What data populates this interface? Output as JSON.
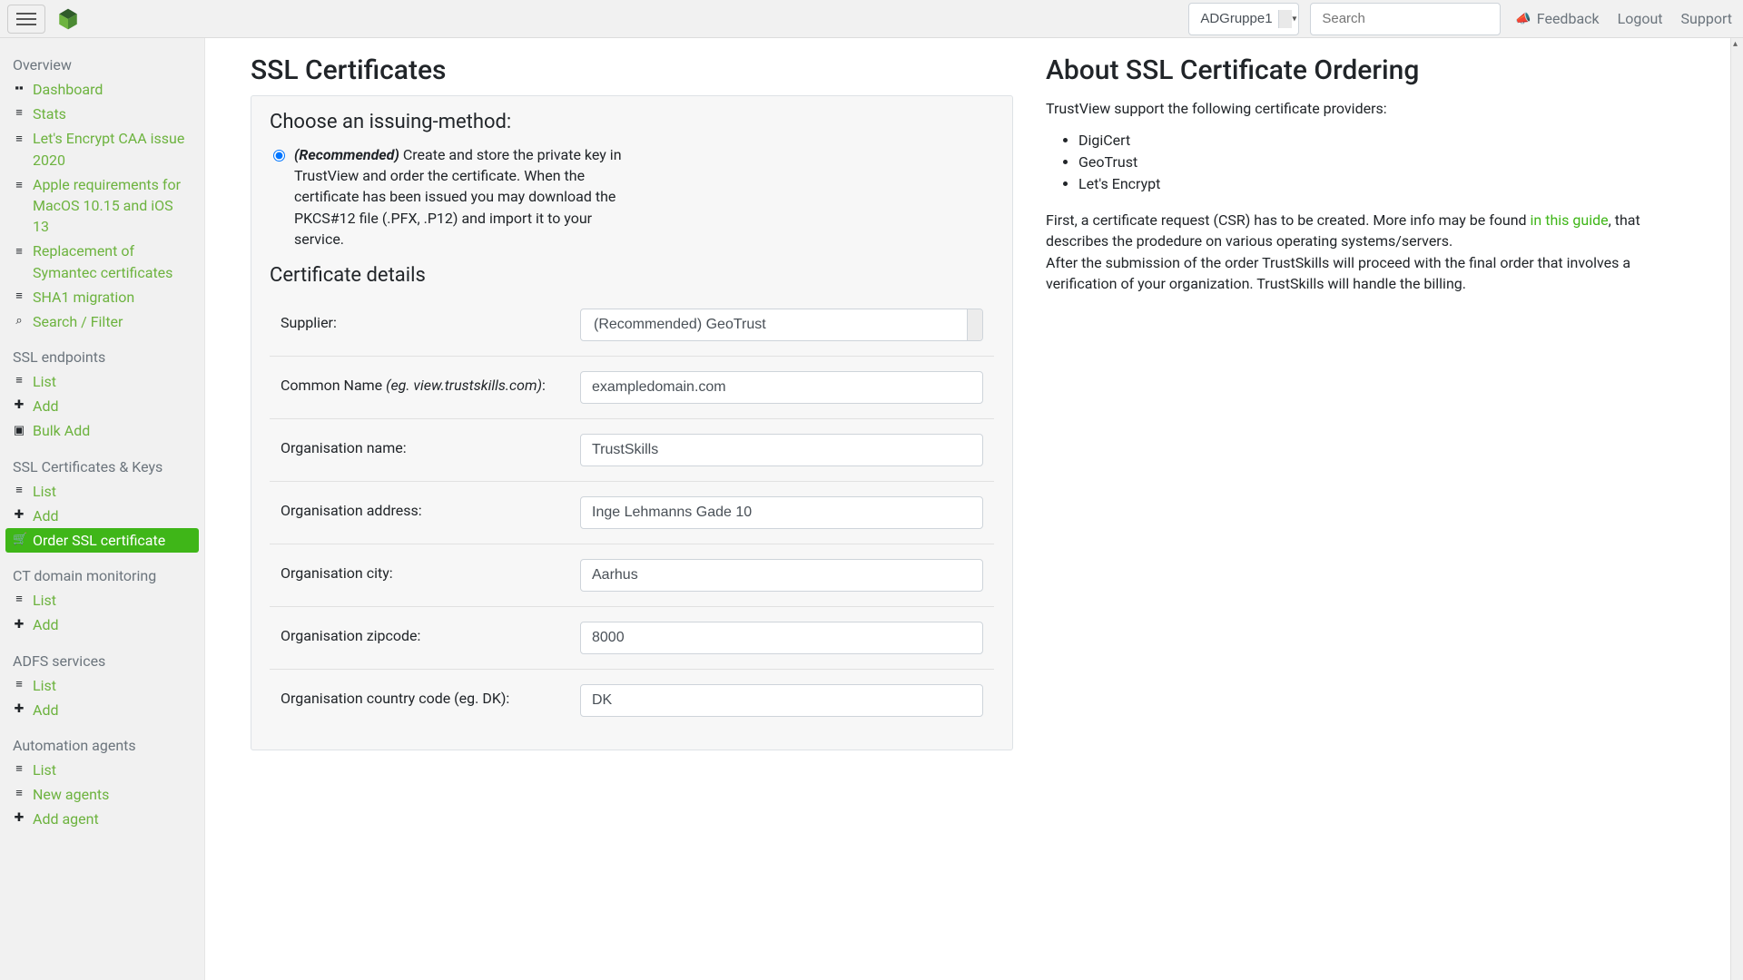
{
  "nav": {
    "group_select": "ADGruppe1",
    "search_placeholder": "Search",
    "feedback": "Feedback",
    "logout": "Logout",
    "support": "Support"
  },
  "sidebar": {
    "sections": [
      {
        "title": "Overview",
        "items": [
          {
            "icon": "dashboard",
            "label": "Dashboard",
            "name": "dashboard"
          },
          {
            "icon": "list",
            "label": "Stats",
            "name": "stats"
          },
          {
            "icon": "list",
            "label": "Let's Encrypt CAA issue 2020",
            "name": "lets-encrypt-caa"
          },
          {
            "icon": "list",
            "label": "Apple requirements for MacOS 10.15 and iOS 13",
            "name": "apple-requirements"
          },
          {
            "icon": "list",
            "label": "Replacement of Symantec certificates",
            "name": "symantec-replacement"
          },
          {
            "icon": "list",
            "label": "SHA1 migration",
            "name": "sha1-migration"
          },
          {
            "icon": "search",
            "label": "Search / Filter",
            "name": "search-filter"
          }
        ]
      },
      {
        "title": "SSL endpoints",
        "items": [
          {
            "icon": "list",
            "label": "List",
            "name": "endpoints-list"
          },
          {
            "icon": "plus",
            "label": "Add",
            "name": "endpoints-add"
          },
          {
            "icon": "bulk",
            "label": "Bulk Add",
            "name": "endpoints-bulk-add"
          }
        ]
      },
      {
        "title": "SSL Certificates & Keys",
        "items": [
          {
            "icon": "list",
            "label": "List",
            "name": "certificates-list"
          },
          {
            "icon": "plus",
            "label": "Add",
            "name": "certificates-add"
          },
          {
            "icon": "cart",
            "label": "Order SSL certificate",
            "name": "order-ssl-certificate",
            "active": true
          }
        ]
      },
      {
        "title": "CT domain monitoring",
        "items": [
          {
            "icon": "list",
            "label": "List",
            "name": "ct-list"
          },
          {
            "icon": "plus",
            "label": "Add",
            "name": "ct-add"
          }
        ]
      },
      {
        "title": "ADFS services",
        "items": [
          {
            "icon": "list",
            "label": "List",
            "name": "adfs-list"
          },
          {
            "icon": "plus",
            "label": "Add",
            "name": "adfs-add"
          }
        ]
      },
      {
        "title": "Automation agents",
        "items": [
          {
            "icon": "list",
            "label": "List",
            "name": "agents-list"
          },
          {
            "icon": "list",
            "label": "New agents",
            "name": "agents-new"
          },
          {
            "icon": "plus",
            "label": "Add agent",
            "name": "agents-add"
          }
        ]
      }
    ]
  },
  "main": {
    "title": "SSL Certificates",
    "issuing_heading": "Choose an issuing-method:",
    "issuing_recommended_label": "(Recommended)",
    "issuing_recommended_text": "Create and store the private key in TrustView and order the certificate. When the certificate has been issued you may download the PKCS#12 file (.PFX, .P12) and import it to your service.",
    "details_heading": "Certificate details",
    "fields": {
      "supplier_label": "Supplier:",
      "supplier_value": "(Recommended) GeoTrust",
      "common_name_label": "Common Name ",
      "common_name_hint": "(eg. view.trustskills.com)",
      "common_name_suffix": ":",
      "common_name_value": "exampledomain.com",
      "org_name_label": "Organisation name:",
      "org_name_value": "TrustSkills",
      "org_address_label": "Organisation address:",
      "org_address_value": "Inge Lehmanns Gade 10",
      "org_city_label": "Organisation city:",
      "org_city_value": "Aarhus",
      "org_zip_label": "Organisation zipcode:",
      "org_zip_value": "8000",
      "org_cc_label": "Organisation country code (eg. DK):",
      "org_cc_value": "DK"
    }
  },
  "aside": {
    "title": "About SSL Certificate Ordering",
    "intro": "TrustView support the following certificate providers:",
    "providers": [
      "DigiCert",
      "GeoTrust",
      "Let's Encrypt"
    ],
    "p2_a": "First, a certificate request (CSR) has to be created. More info may be found ",
    "p2_link": "in this guide",
    "p2_b": ", that describes the prodedure on various operating systems/servers.",
    "p3": "After the submission of the order TrustSkills will proceed with the final order that involves a verification of your organization. TrustSkills will handle the billing."
  }
}
